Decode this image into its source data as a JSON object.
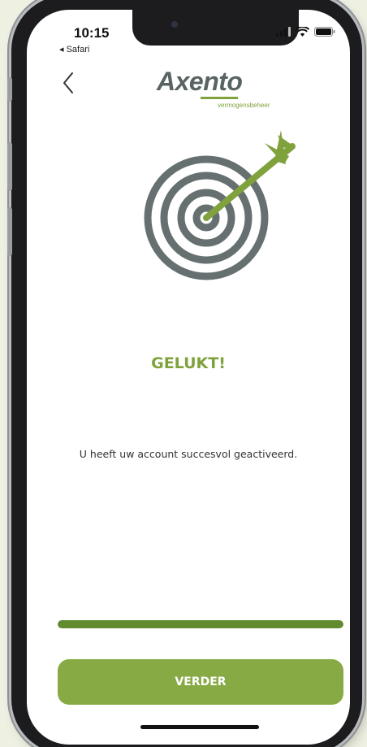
{
  "status_bar": {
    "time": "10:15",
    "back_app": "◂ Safari",
    "icons": [
      "cellular-signal-icon",
      "wifi-icon",
      "battery-icon"
    ]
  },
  "nav": {
    "back_icon": "chevron-left-icon"
  },
  "brand": {
    "logo_text": "Axento",
    "logo_subtext": "vermogensbeheer",
    "colors": {
      "green": "#7fa23c",
      "dark_green": "#628a2e",
      "grey": "#596363"
    }
  },
  "illustration": {
    "icon": "target-with-arrow-icon"
  },
  "content": {
    "title": "GELUKT!",
    "message": "U heeft uw account succesvol geactiveerd."
  },
  "progress": {
    "percent": 100
  },
  "actions": {
    "continue_label": "VERDER"
  }
}
